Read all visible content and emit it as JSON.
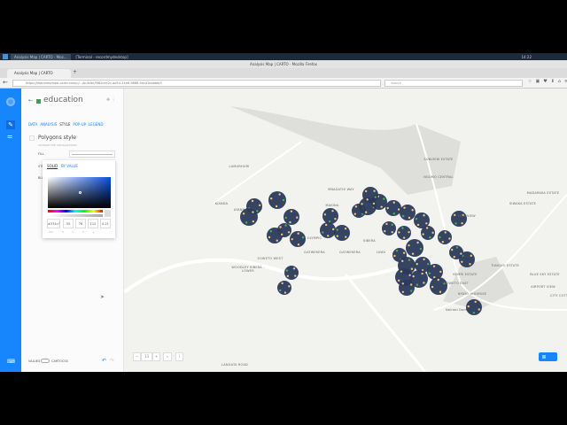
{
  "taskbar": {
    "tasks": [
      "Analysis Map | CARTO - Moz...",
      "[Terminal - recordmydesktop]"
    ],
    "clock": "14:22"
  },
  "window": {
    "title": "Analysis Map | CARTO - Mozilla Firefox"
  },
  "browser": {
    "tab_title": "Analysis Map | CARTO",
    "url": "https://theroneschool.carto.com/u/.../builder/5f62ce42c-ad54-11e6-9866-0ecd1babbfe5",
    "search_placeholder": "Search"
  },
  "panel": {
    "layer_name": "education",
    "tabs": [
      "DATA",
      "ANALYSIS",
      "STYLE",
      "POP-UP",
      "LEGEND"
    ],
    "active_tab": "STYLE",
    "section_title": "Polygons style",
    "section_subtitle": "CHANGE THE VISUALIZATION",
    "fill_label": "FILL",
    "stroke_label": "STR",
    "blend_label": "BLE",
    "picker": {
      "tabs": [
        "SOLID",
        "BY VALUE"
      ],
      "active": "SOLID",
      "hex": "#374c7",
      "r": "55",
      "g": "76",
      "b": "112",
      "a": "0.21",
      "value_labels": [
        "HEX",
        "R",
        "G",
        "B",
        "A"
      ],
      "color": "#374c70"
    },
    "footer": {
      "left": "VALUES",
      "right": "CARTOCSS"
    }
  },
  "map": {
    "labels": [
      "LANGATA ROAD",
      "WOODLEY KIBERA - LOWER",
      "KIANDA",
      "AYANY",
      "MAKINA",
      "OLYMPIC",
      "GATWEKERA",
      "GATWEKERA",
      "SOWETO WEST",
      "KIBERA",
      "LINDI",
      "SUNVIEW ESTATE",
      "NGUMO CENTRAL",
      "HIGHVIEW",
      "SOWETO EAST",
      "KEMRI ESTATE",
      "NYAYO HIGHRISE",
      "MADARAKA ESTATE",
      "SIWAKA ESTATE",
      "TUNGUO ESTATE",
      "BLUE SKY ESTATE",
      "AIRPORT VIEW",
      "CITY COTTAGE",
      "LAMURHURI",
      "MBAGATHI WAY",
      "Nairobi Dam"
    ],
    "circle_color": "#2b3a5c",
    "point_color": "#f2c27a",
    "accent": "#1785fb",
    "zoom_level": "13"
  }
}
